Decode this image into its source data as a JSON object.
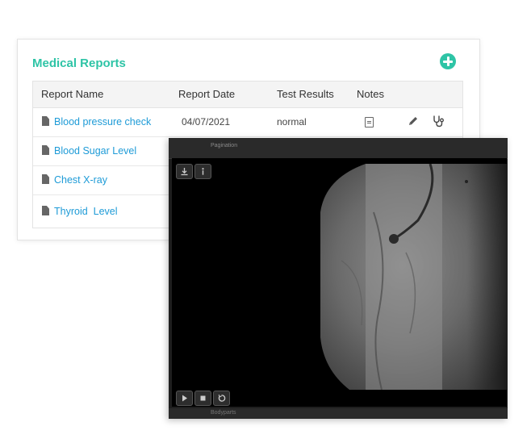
{
  "reports": {
    "title": "Medical Reports",
    "add_icon": "plus-circle-icon",
    "accent_color": "#2ec4a6",
    "link_color": "#1e9bd7",
    "columns": [
      "Report Name",
      "Report Date",
      "Test Results",
      "Notes"
    ],
    "rows": [
      {
        "name": "Blood pressure check",
        "date": "04/07/2021",
        "result": "normal",
        "icons": [
          "note-icon",
          "pencil-icon",
          "stethoscope-icon"
        ]
      },
      {
        "name": "Blood Sugar Level",
        "date": "",
        "result": ""
      },
      {
        "name": "Chest X-ray",
        "date": "",
        "result": ""
      },
      {
        "name": "Thyroid  Level",
        "date": "",
        "result": ""
      }
    ]
  },
  "viewer": {
    "top_caption": "Pagination",
    "bottom_caption": "Bodyparts",
    "toolbar_top": [
      "download-icon",
      "info-icon"
    ],
    "toolbar_bottom": [
      "play-icon",
      "stop-icon",
      "reset-icon"
    ]
  }
}
